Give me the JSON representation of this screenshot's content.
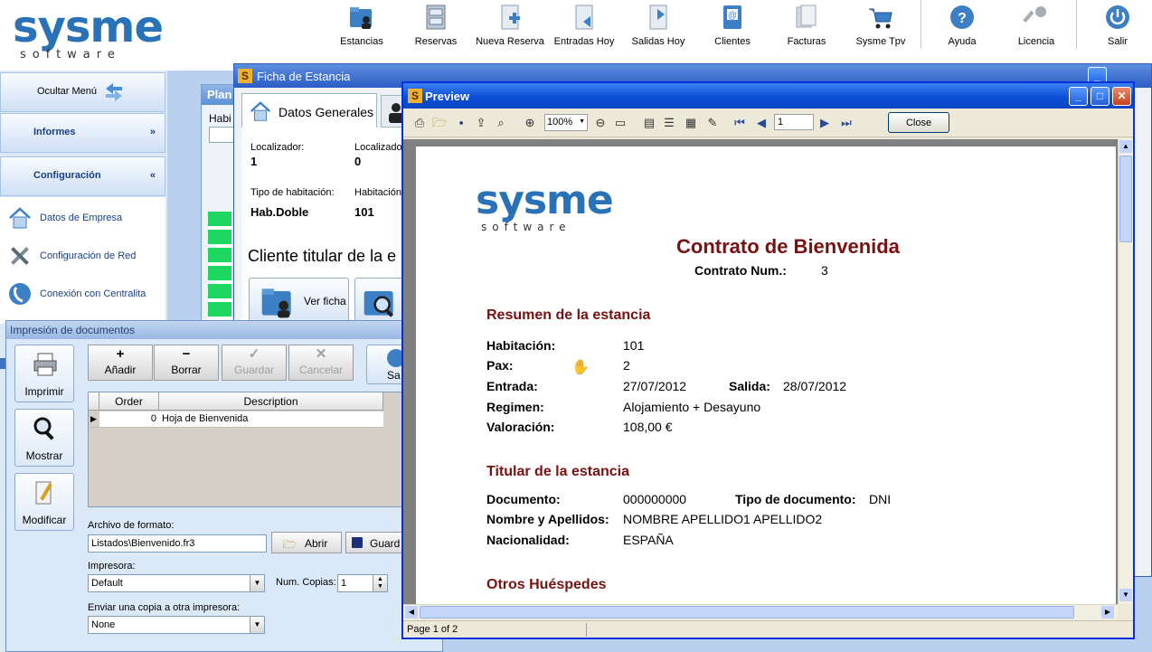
{
  "app": {
    "logo_main": "sysme",
    "logo_sub": "software"
  },
  "toolbar": {
    "items": [
      {
        "label": "Estancias",
        "icon": "folder-user-icon"
      },
      {
        "label": "Reservas",
        "icon": "file-cabinet-icon"
      },
      {
        "label": "Nueva Reserva",
        "icon": "new-document-icon"
      },
      {
        "label": "Entradas Hoy",
        "icon": "document-in-icon"
      },
      {
        "label": "Salidas Hoy",
        "icon": "document-out-icon"
      },
      {
        "label": "Clientes",
        "icon": "address-book-icon"
      },
      {
        "label": "Facturas",
        "icon": "invoices-icon"
      },
      {
        "label": "Sysme Tpv",
        "icon": "shopping-cart-icon"
      },
      {
        "label": "Ayuda",
        "icon": "help-icon"
      },
      {
        "label": "Licencia",
        "icon": "key-icon"
      },
      {
        "label": "Salir",
        "icon": "power-icon"
      }
    ]
  },
  "leftnav": {
    "hide_menu": "Ocultar Menú",
    "informes": "Informes",
    "configuracion": "Configuración",
    "items": [
      {
        "label": "Datos de Empresa"
      },
      {
        "label": "Configuración de Red"
      },
      {
        "label": "Conexión con Centralita"
      }
    ]
  },
  "plan": {
    "title": "Plan",
    "col": "Habi"
  },
  "ficha": {
    "title": "Ficha de Estancia",
    "tab_general": "Datos Generales",
    "localizador_label": "Localizador:",
    "localizador_value": "1",
    "localizador2_label": "Localizador",
    "localizador2_value": "0",
    "tipo_label": "Tipo de habitación:",
    "tipo_value": "Hab.Doble",
    "hab_label": "Habitación",
    "hab_value": "101",
    "cliente_heading": "Cliente titular de la e",
    "ver_ficha": "Ver ficha"
  },
  "impresion": {
    "title": "Impresión de documentos",
    "side_buttons": [
      {
        "label": "Imprimir",
        "icon": "printer-icon"
      },
      {
        "label": "Mostrar",
        "icon": "magnifier-icon"
      },
      {
        "label": "Modificar",
        "icon": "edit-document-icon"
      }
    ],
    "actions": {
      "add": "Añadir",
      "delete": "Borrar",
      "save": "Guardar",
      "cancel": "Cancelar",
      "exit": "Sa"
    },
    "grid": {
      "col_order": "Order",
      "col_desc": "Description",
      "rows": [
        {
          "order": "0",
          "description": "Hoja de Bienvenida"
        }
      ]
    },
    "format_label": "Archivo de formato:",
    "format_value": "Listados\\Bienvenido.fr3",
    "open_btn": "Abrir",
    "save_btn": "Guard",
    "printer_label": "Impresora:",
    "printer_value": "Default",
    "copies_label": "Num. Copias:",
    "copies_value": "1",
    "copy_label": "Enviar una copia a otra impresora:",
    "copy_value": "None"
  },
  "preview": {
    "title": "Preview",
    "zoom": "100%",
    "page_input": "1",
    "close_btn": "Close",
    "status": "Page 1 of 2",
    "report": {
      "logo_main": "sysme",
      "logo_sub": "software",
      "heading": "Contrato de Bienvenida",
      "contrato_label": "Contrato Num.:",
      "contrato_value": "3",
      "sec_resumen": "Resumen de la estancia",
      "habitacion_label": "Habitación:",
      "habitacion_value": "101",
      "pax_label": "Pax:",
      "pax_value": "2",
      "entrada_label": "Entrada:",
      "entrada_value": "27/07/2012",
      "salida_label": "Salida:",
      "salida_value": "28/07/2012",
      "regimen_label": "Regimen:",
      "regimen_value": "Alojamiento + Desayuno",
      "valoracion_label": "Valoración:",
      "valoracion_value": "108,00 €",
      "sec_titular": "Titular de la estancia",
      "documento_label": "Documento:",
      "documento_value": "000000000",
      "tipodoc_label": "Tipo de documento:",
      "tipodoc_value": "DNI",
      "nombre_label": "Nombre y Apellidos:",
      "nombre_value": "NOMBRE APELLIDO1 APELLIDO2",
      "nacionalidad_label": "Nacionalidad:",
      "nacionalidad_value": "ESPAÑA",
      "sec_otros": "Otros Huéspedes"
    }
  },
  "colors": {
    "logo_blue": "#2a72b8",
    "logo_dark": "#333333",
    "report_red": "#7a1010",
    "xp_title": "#0c4fd6"
  }
}
